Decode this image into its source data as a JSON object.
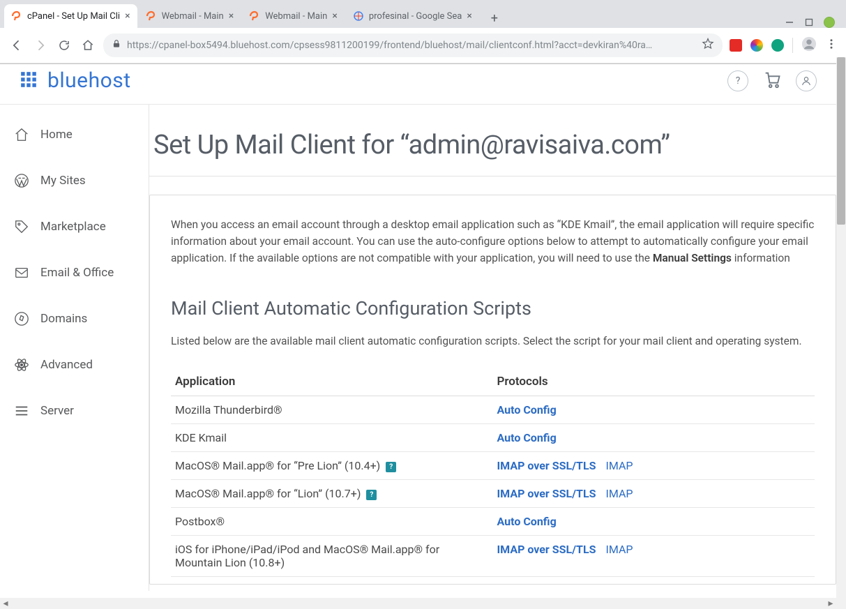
{
  "browser": {
    "tabs": [
      {
        "title": "cPanel - Set Up Mail Cli",
        "favicon": "cpanel"
      },
      {
        "title": "Webmail - Main",
        "favicon": "cpanel"
      },
      {
        "title": "Webmail - Main",
        "favicon": "cpanel"
      },
      {
        "title": "profesinal - Google Sea",
        "favicon": "google"
      }
    ],
    "url_host": "https://cpanel-box5494.bluehost.com",
    "url_path": "/cpsess9811200199/frontend/bluehost/mail/clientconf.html?acct=devkiran%40ra…"
  },
  "brand": "bluehost",
  "sidebar": {
    "items": [
      {
        "label": "Home",
        "icon": "home"
      },
      {
        "label": "My Sites",
        "icon": "wordpress"
      },
      {
        "label": "Marketplace",
        "icon": "tag"
      },
      {
        "label": "Email & Office",
        "icon": "mail"
      },
      {
        "label": "Domains",
        "icon": "compass"
      },
      {
        "label": "Advanced",
        "icon": "atom"
      },
      {
        "label": "Server",
        "icon": "menu"
      }
    ]
  },
  "page_title": "Set Up Mail Client for “admin@ravisaiva.com”",
  "intro": {
    "before": "When you access an email account through a desktop email application such as “KDE Kmail”, the email application will require specific information about your email account. You can use the auto-configure options below to attempt to automatically configure your email application. If the available options are not compatible with your application, you will need to use the ",
    "bold": "Manual Settings",
    "after": " information"
  },
  "section_title": "Mail Client Automatic Configuration Scripts",
  "section_sub": "Listed below are the available mail client automatic configuration scripts. Select the script for your mail client and operating system.",
  "table": {
    "headers": {
      "app": "Application",
      "proto": "Protocols"
    },
    "rows": [
      {
        "app": "Mozilla Thunderbird®",
        "primary": "Auto Config",
        "secondary": "",
        "help": false
      },
      {
        "app": "KDE Kmail",
        "primary": "Auto Config",
        "secondary": "",
        "help": false
      },
      {
        "app": "MacOS® Mail.app® for “Pre Lion” (10.4+)",
        "primary": "IMAP over SSL/TLS",
        "secondary": "IMAP",
        "help": true
      },
      {
        "app": "MacOS® Mail.app® for “Lion” (10.7+)",
        "primary": "IMAP over SSL/TLS",
        "secondary": "IMAP",
        "help": true
      },
      {
        "app": "Postbox®",
        "primary": "Auto Config",
        "secondary": "",
        "help": false
      },
      {
        "app": "iOS for iPhone/iPad/iPod and MacOS® Mail.app® for Mountain Lion (10.8+)",
        "primary": "IMAP over SSL/TLS",
        "secondary": "IMAP",
        "help": false
      }
    ]
  }
}
